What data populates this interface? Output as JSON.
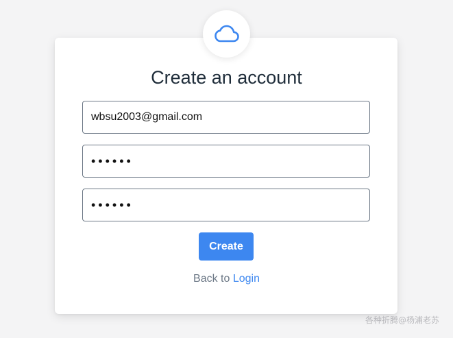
{
  "form": {
    "title": "Create an account",
    "email_value": "wbsu2003@gmail.com",
    "password_value": "••••••",
    "confirm_password_value": "••••••",
    "create_label": "Create",
    "back_text": "Back to",
    "login_label": "Login"
  },
  "watermark": "各种折腾@杨浦老苏",
  "icons": {
    "logo": "cloud-icon"
  },
  "colors": {
    "accent": "#3d87f0",
    "title": "#1f2d3a",
    "muted": "#6b7785",
    "background": "#f4f4f5"
  }
}
